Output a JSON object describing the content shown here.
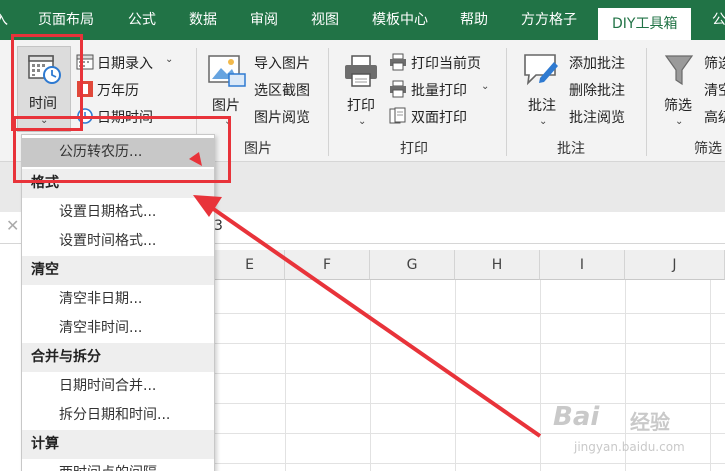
{
  "tabs": [
    {
      "label": "入",
      "active": false
    },
    {
      "label": "页面布局",
      "active": false
    },
    {
      "label": "公式",
      "active": false
    },
    {
      "label": "数据",
      "active": false
    },
    {
      "label": "审阅",
      "active": false
    },
    {
      "label": "视图",
      "active": false
    },
    {
      "label": "模板中心",
      "active": false
    },
    {
      "label": "帮助",
      "active": false
    },
    {
      "label": "方方格子",
      "active": false
    },
    {
      "label": "DIY工具箱",
      "active": true
    },
    {
      "label": "公",
      "active": false
    }
  ],
  "ribbon": {
    "time_group": {
      "time_button": "时间",
      "date_entry": "日期录入",
      "perpetual_calendar": "万年历",
      "date_time": "日期时间"
    },
    "image_group": {
      "image_button": "图片",
      "import_image": "导入图片",
      "area_screenshot": "选区截图",
      "image_preview": "图片阅览",
      "title": "图片"
    },
    "print_group": {
      "print_button": "打印",
      "print_current_page": "打印当前页",
      "batch_print": "批量打印",
      "duplex_print": "双面打印",
      "title": "打印"
    },
    "comment_group": {
      "comment_button": "批注",
      "add_comment": "添加批注",
      "delete_comment": "删除批注",
      "comment_preview": "批注阅览",
      "title": "批注"
    },
    "filter_group": {
      "filter_button": "筛选",
      "item1": "筛选",
      "item2": "清空",
      "item3": "高级",
      "title": "筛选"
    }
  },
  "columns": [
    "E",
    "F",
    "G",
    "H",
    "I",
    "J"
  ],
  "dropdown": {
    "top_item": "公历转农历...",
    "sections": [
      {
        "header": "格式",
        "items": [
          "设置日期格式...",
          "设置时间格式..."
        ]
      },
      {
        "header": "清空",
        "items": [
          "清空非日期...",
          "清空非时间..."
        ]
      },
      {
        "header": "合并与拆分",
        "items": [
          "日期时间合并...",
          "拆分日期和时间..."
        ]
      },
      {
        "header": "计算",
        "items": [
          "两时间点的间隔..."
        ]
      }
    ]
  },
  "partial_text": "3",
  "watermark": {
    "brand": "Bai",
    "brand2": "经验",
    "url": "jingyan.baidu.com"
  },
  "colors": {
    "accent": "#217346",
    "highlight": "#e8333a"
  }
}
